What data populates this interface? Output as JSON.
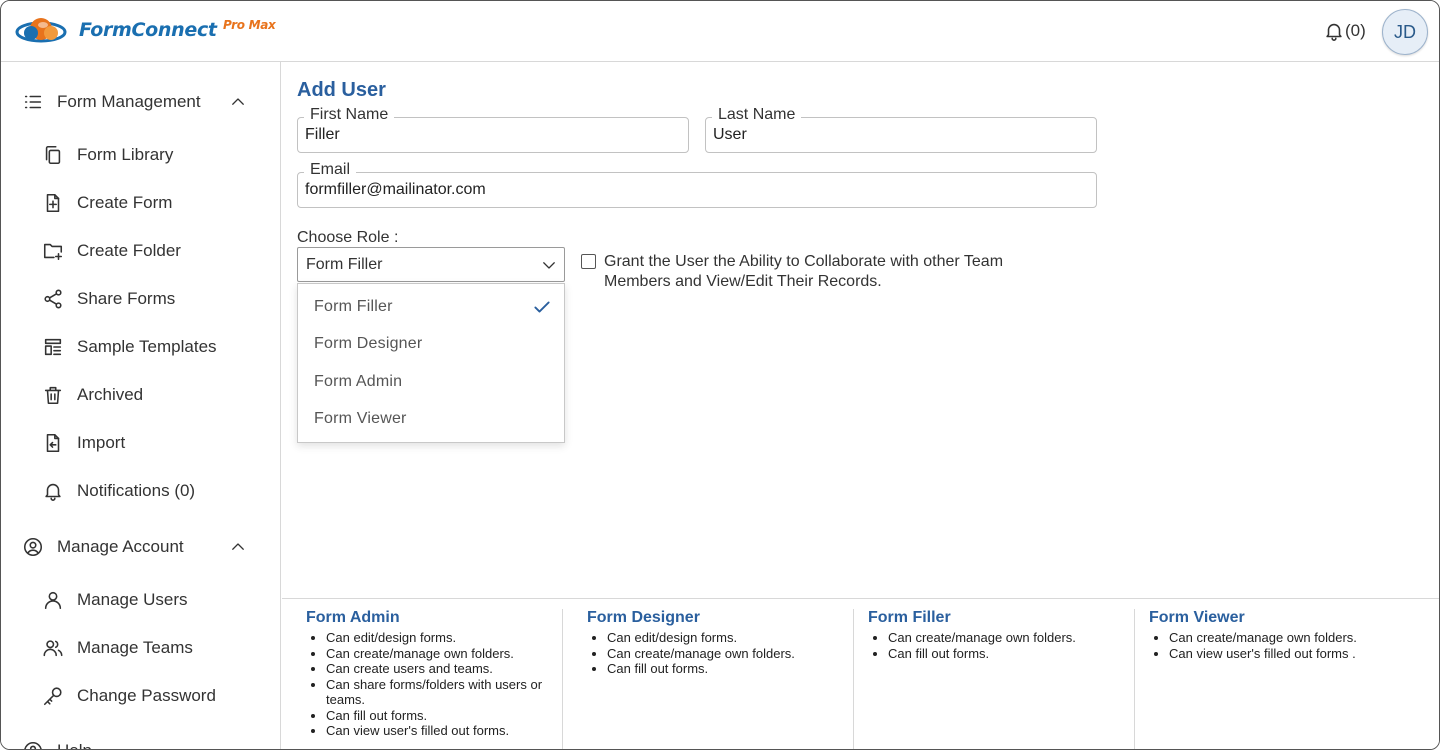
{
  "header": {
    "logo": {
      "part1": "Form",
      "part2": "Connect",
      "part3": "Pro Max"
    },
    "notifications_count": "(0)",
    "avatar_initials": "JD"
  },
  "sidebar": {
    "section1": {
      "title": "Form Management",
      "items": [
        {
          "label": "Form Library",
          "icon": "copy-icon"
        },
        {
          "label": "Create Form",
          "icon": "file-plus-icon"
        },
        {
          "label": "Create Folder",
          "icon": "folder-plus-icon"
        },
        {
          "label": "Share Forms",
          "icon": "share-icon"
        },
        {
          "label": "Sample Templates",
          "icon": "template-icon"
        },
        {
          "label": "Archived",
          "icon": "trash-icon"
        },
        {
          "label": "Import",
          "icon": "import-icon"
        },
        {
          "label": "Notifications (0)",
          "icon": "bell-icon"
        }
      ]
    },
    "section2": {
      "title": "Manage Account",
      "items": [
        {
          "label": "Manage Users",
          "icon": "user-icon"
        },
        {
          "label": "Manage Teams",
          "icon": "users-icon"
        },
        {
          "label": "Change Password",
          "icon": "key-icon"
        }
      ]
    },
    "section3": {
      "title": "Help"
    }
  },
  "form": {
    "title": "Add User",
    "first_name": {
      "label": "First Name",
      "value": "Filler"
    },
    "last_name": {
      "label": "Last Name",
      "value": "User"
    },
    "email": {
      "label": "Email",
      "value": "formfiller@mailinator.com"
    },
    "role": {
      "label": "Choose Role :",
      "selected": "Form Filler",
      "options": [
        "Form Filler",
        "Form Designer",
        "Form Admin",
        "Form Viewer"
      ]
    },
    "collaborate": {
      "checked": false,
      "label": "Grant the User the Ability to Collaborate with other Team Members and View/Edit Their Records."
    }
  },
  "roles_info": [
    {
      "name": "Form Admin",
      "perms": [
        "Can edit/design forms.",
        "Can create/manage own folders.",
        "Can create users and teams.",
        "Can share forms/folders with users or teams.",
        "Can fill out forms.",
        "Can view user's filled out forms."
      ]
    },
    {
      "name": "Form Designer",
      "perms": [
        "Can edit/design forms.",
        "Can create/manage own folders.",
        "Can fill out forms."
      ]
    },
    {
      "name": "Form Filler",
      "perms": [
        "Can create/manage own folders.",
        "Can fill out forms."
      ]
    },
    {
      "name": "Form Viewer",
      "perms": [
        "Can create/manage own folders.",
        "Can view user's filled out forms ."
      ]
    }
  ],
  "colors": {
    "accent": "#2a5f9e",
    "logo_blue": "#1a6fb0",
    "logo_orange": "#e8731c"
  }
}
